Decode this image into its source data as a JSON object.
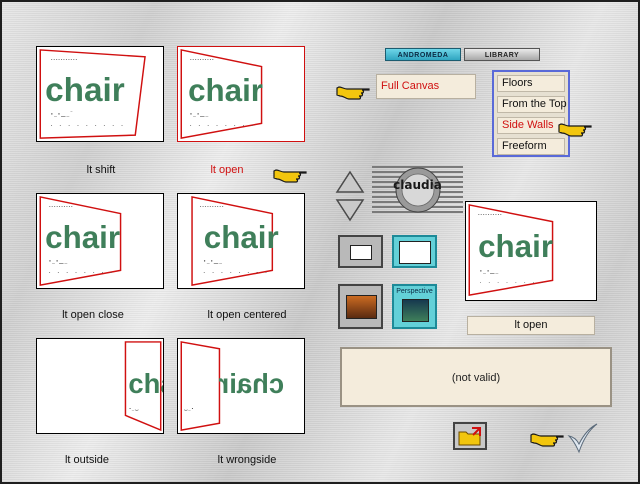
{
  "thumbnails": [
    {
      "label": "lt shift",
      "logo_text": "chair",
      "selected": false
    },
    {
      "label": "lt open",
      "logo_text": "chair",
      "selected": true
    },
    {
      "label": "lt open close",
      "logo_text": "chair",
      "selected": false
    },
    {
      "label": "lt open centered",
      "logo_text": "chair",
      "selected": false
    },
    {
      "label": "lt outside",
      "logo_text": "chair",
      "selected": false
    },
    {
      "label": "lt wrongside",
      "logo_text": "chair",
      "selected": false
    }
  ],
  "tabs": {
    "andromeda": "ANDROMEDA",
    "library": "LIBRARY"
  },
  "canvas_mode": {
    "value": "Full Canvas"
  },
  "category_list": [
    "Floors",
    "From the Top",
    "Side Walls",
    "Freeform"
  ],
  "selected_category": "Side Walls",
  "watermark_text": "claudia",
  "preview": {
    "label": "lt open",
    "logo_text": "chair"
  },
  "preset_thumb_text": "Perspective",
  "status_text": "(not valid)",
  "colors": {
    "accent_red": "#d01010",
    "list_border": "#5a6ad8",
    "field_bg": "#f4ecdc",
    "pointer_yellow": "#f2c60e"
  },
  "icons": [
    "hand-pointer-icon",
    "arrow-up-icon",
    "arrow-down-icon",
    "folder-open-icon",
    "checkmark-icon"
  ]
}
